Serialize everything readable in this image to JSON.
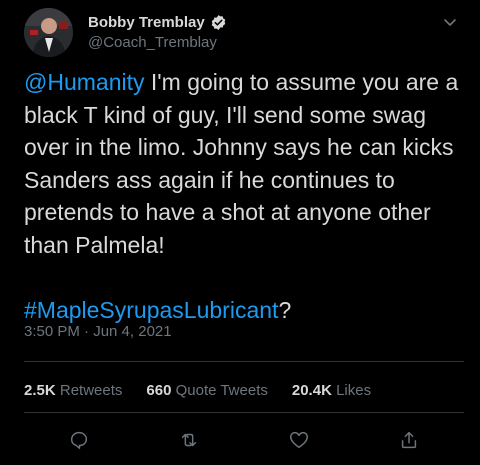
{
  "author": {
    "display_name": "Bobby Tremblay",
    "handle": "@Coach_Tremblay",
    "verified": true
  },
  "tweet": {
    "mention": "@Humanity",
    "body": " I'm going to assume you are a black T kind of guy, I'll send some swag over in the limo. Johnny says he can kicks Sanders ass again if he continues to pretends to have a shot at anyone other than Palmela!\n\n",
    "hashtag": "#MapleSyrupasLubricant",
    "trailing": "?"
  },
  "timestamp": "3:50 PM · Jun 4, 2021",
  "stats": {
    "retweets_count": "2.5K",
    "retweets_label": "Retweets",
    "quotes_count": "660",
    "quotes_label": "Quote Tweets",
    "likes_count": "20.4K",
    "likes_label": "Likes"
  },
  "actions": {
    "reply": "reply-icon",
    "retweet": "retweet-icon",
    "like": "like-icon",
    "share": "share-icon"
  },
  "colors": {
    "background": "#000000",
    "text": "#d9d9d9",
    "secondary": "#6e767d",
    "link": "#1d9bf0",
    "divider": "#2f3336"
  }
}
